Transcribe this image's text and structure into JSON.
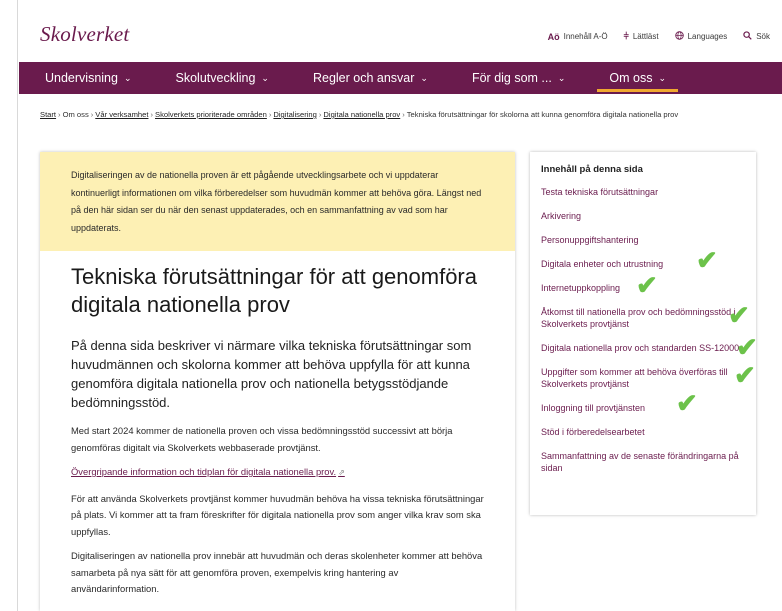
{
  "header": {
    "logo": "Skolverket",
    "utils": [
      {
        "icon": "Aö",
        "label": "Innehåll A-Ö"
      },
      {
        "icon": "⫩",
        "label": "Lättläst"
      },
      {
        "icon": "🌐",
        "label": "Languages"
      },
      {
        "icon": "⚲",
        "label": "Sök"
      }
    ]
  },
  "nav": [
    {
      "label": "Undervisning"
    },
    {
      "label": "Skolutveckling"
    },
    {
      "label": "Regler och ansvar"
    },
    {
      "label": "För dig som ..."
    },
    {
      "label": "Om oss"
    }
  ],
  "breadcrumb": {
    "items": [
      "Start",
      "Om oss",
      "Vår verksamhet",
      "Skolverkets prioriterade områden",
      "Digitalisering",
      "Digitala nationella prov"
    ],
    "current": "Tekniska förutsättningar för skolorna att kunna genomföra digitala nationella prov"
  },
  "notice": "Digitaliseringen av de nationella proven är ett pågående utvecklingsarbete och vi uppdaterar kontinuerligt informationen om vilka förberedelser som huvudmän kommer att behöva göra. Längst ned på den här sidan ser du när den senast uppdaterades, och en sammanfattning av vad som har uppdaterats.",
  "article": {
    "title": "Tekniska förutsättningar för att genomföra digitala nationella prov",
    "lead": "På denna sida beskriver vi närmare vilka tekniska förutsättningar som huvudmännen och skolorna kommer att behöva uppfylla för att kunna genomföra digitala nationella prov och nationella betygsstödjande bedömningsstöd.",
    "p1": "Med start 2024 kommer de nationella proven och vissa bedömningsstöd successivt att börja genomföras digitalt via Skolverkets webbaserade provtjänst.",
    "link": "Övergripande information och tidplan för digitala nationella prov.",
    "p2": "För att använda Skolverkets provtjänst kommer huvudmän behöva ha vissa tekniska förutsättningar på plats. Vi kommer att ta fram föreskrifter för digitala nationella prov som anger vilka krav som ska uppfyllas.",
    "p3": "Digitaliseringen av nationella prov innebär att huvudmän och deras skolenheter kommer att behöva samarbeta på nya sätt för att genomföra proven, exempelvis kring hantering av användarinformation."
  },
  "toc": {
    "title": "Innehåll på denna sida",
    "items": [
      "Testa tekniska förutsättningar",
      "Arkivering",
      "Personuppgiftshantering",
      "Digitala enheter och utrustning",
      "Internetuppkoppling",
      "Åtkomst till nationella prov och bedömningsstöd i Skolverkets provtjänst",
      "Digitala nationella prov och standarden SS-12000",
      "Uppgifter som kommer att behöva överföras till Skolverkets provtjänst",
      "Inloggning till provtjänsten",
      "Stöd i förberedelsearbetet",
      "Sammanfattning av de senaste förändringarna på sidan"
    ]
  },
  "colors": {
    "brand": "#6a1b4d",
    "notice_bg": "#fdf0b4",
    "check": "#6cc24a",
    "nav_accent": "#f0a830"
  }
}
